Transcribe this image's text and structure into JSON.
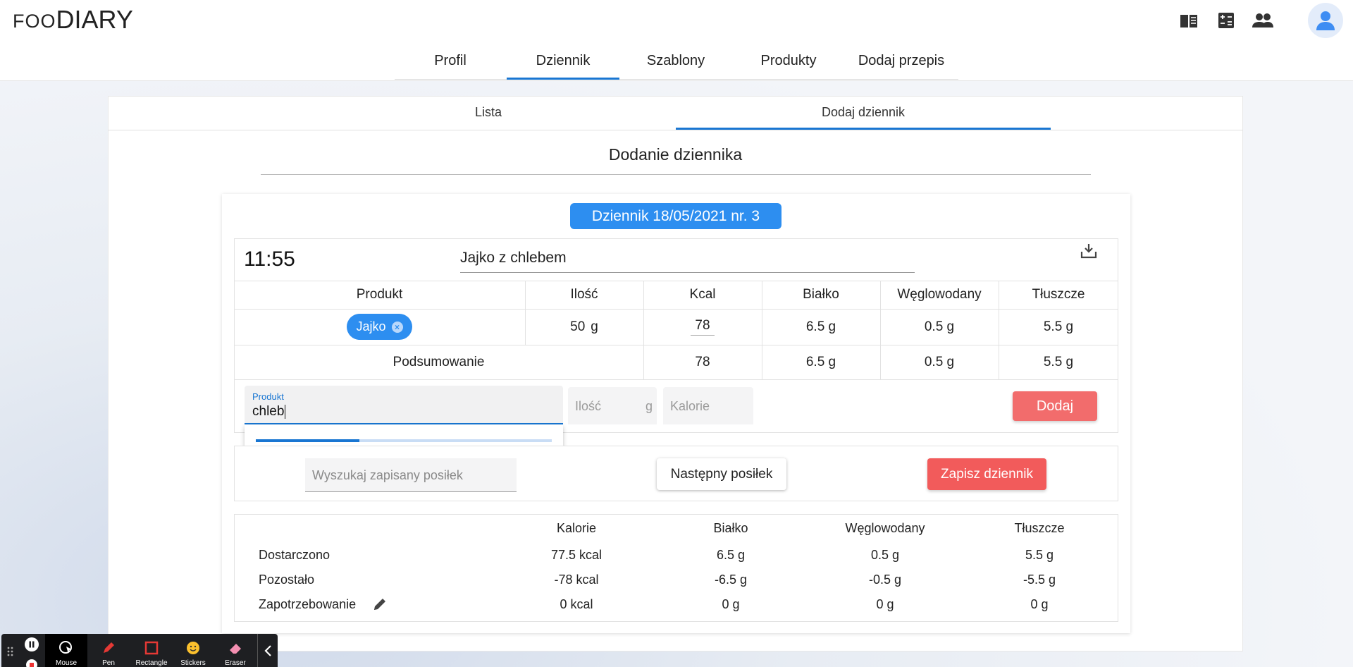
{
  "app": {
    "logo_small": "FOO",
    "logo_big": "DIARY"
  },
  "header_icons": [
    "book-icon",
    "calculator-icon",
    "people-icon",
    "avatar-icon"
  ],
  "main_nav": [
    {
      "label": "Profil",
      "active": false
    },
    {
      "label": "Dziennik",
      "active": true
    },
    {
      "label": "Szablony",
      "active": false
    },
    {
      "label": "Produkty",
      "active": false
    },
    {
      "label": "Dodaj przepis",
      "active": false
    }
  ],
  "sub_tabs": [
    {
      "label": "Lista",
      "active": false
    },
    {
      "label": "Dodaj dziennik",
      "active": true
    }
  ],
  "page_title": "Dodanie dziennika",
  "diary_badge": "Dziennik 18/05/2021 nr. 3",
  "meal": {
    "time": "11:55",
    "name": "Jajko z chlebem",
    "columns": [
      "Produkt",
      "Ilość",
      "Kcal",
      "Białko",
      "Węglowodany",
      "Tłuszcze"
    ],
    "items": [
      {
        "product": "Jajko",
        "qty": "50",
        "unit": "g",
        "kcal": "78",
        "protein": "6.5 g",
        "carbs": "0.5 g",
        "fat": "5.5 g"
      }
    ],
    "summary": {
      "label": "Podsumowanie",
      "kcal": "78",
      "protein": "6.5 g",
      "carbs": "0.5 g",
      "fat": "5.5 g"
    }
  },
  "add_form": {
    "product_label": "Produkt",
    "product_value": "chleb",
    "qty_placeholder": "Ilość",
    "qty_unit": "g",
    "calories_placeholder": "Kalorie",
    "add_button": "Dodaj",
    "loading_progress": 0.35
  },
  "actions": {
    "search_placeholder": "Wyszukaj zapisany posiłek",
    "next_meal_button": "Następny posiłek",
    "save_button": "Zapisz dziennik"
  },
  "totals": {
    "columns": [
      "Kalorie",
      "Białko",
      "Węglowodany",
      "Tłuszcze"
    ],
    "rows": [
      {
        "label": "Dostarczono",
        "values": [
          "77.5 kcal",
          "6.5 g",
          "0.5 g",
          "5.5 g"
        ]
      },
      {
        "label": "Pozostało",
        "values": [
          "-78 kcal",
          "-6.5 g",
          "-0.5 g",
          "-5.5 g"
        ]
      },
      {
        "label": "Zapotrzebowanie",
        "values": [
          "0 kcal",
          "0 g",
          "0 g",
          "0 g"
        ]
      }
    ]
  },
  "recorder_toolbar": [
    {
      "label": "Mouse",
      "icon": "mouse-icon"
    },
    {
      "label": "Pen",
      "icon": "pen-icon"
    },
    {
      "label": "Rectangle",
      "icon": "rectangle-icon"
    },
    {
      "label": "Stickers",
      "icon": "sticker-icon"
    },
    {
      "label": "Eraser",
      "icon": "eraser-icon"
    }
  ],
  "colors": {
    "primary": "#1976d2",
    "badge": "#2d8ef0",
    "danger": "#f26c6c"
  }
}
